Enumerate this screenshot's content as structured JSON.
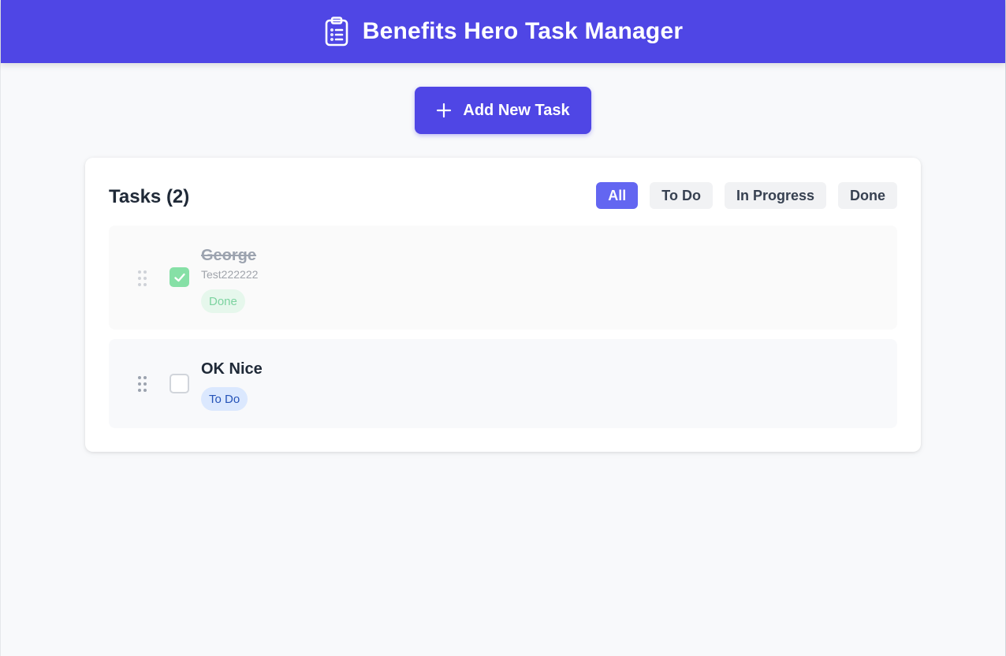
{
  "header": {
    "title": "Benefits Hero Task Manager",
    "icon": "clipboard-list-icon"
  },
  "toolbar": {
    "add_label": "Add New Task",
    "add_icon": "plus-icon"
  },
  "tasks_panel": {
    "title": "Tasks (2)",
    "filters": [
      {
        "label": "All",
        "active": true
      },
      {
        "label": "To Do",
        "active": false
      },
      {
        "label": "In Progress",
        "active": false
      },
      {
        "label": "Done",
        "active": false
      }
    ],
    "items": [
      {
        "title": "George",
        "description": "Test222222",
        "status": "Done",
        "completed": true
      },
      {
        "title": "OK Nice",
        "description": "",
        "status": "To Do",
        "completed": false
      }
    ]
  },
  "colors": {
    "brand": "#4f46e5",
    "filter_active": "#6366f1",
    "done_badge_bg": "#e6f7ec",
    "done_badge_text": "#7dd3a0",
    "todo_badge_bg": "#dbe8fe",
    "todo_badge_text": "#2553b8",
    "check_done": "#86e0a6"
  }
}
